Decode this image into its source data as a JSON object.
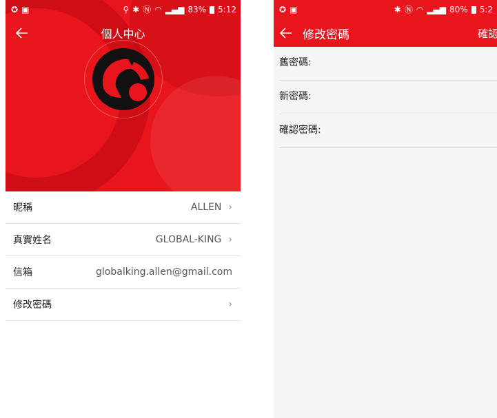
{
  "left": {
    "status": {
      "percent": "83%",
      "time": "5:12"
    },
    "title": "個人中心",
    "rows": [
      {
        "label": "昵稱",
        "value": "ALLEN",
        "chevron": true
      },
      {
        "label": "真實姓名",
        "value": "GLOBAL-KING",
        "chevron": true
      },
      {
        "label": "信箱",
        "value": "globalking.allen@gmail.com",
        "chevron": false
      },
      {
        "label": "修改密碼",
        "value": "",
        "chevron": true
      }
    ]
  },
  "right": {
    "status": {
      "percent": "80%",
      "time": "5:2"
    },
    "title": "修改密碼",
    "confirm": "確認",
    "fields": [
      {
        "label": "舊密碼:",
        "value": ""
      },
      {
        "label": "新密碼:",
        "value": ""
      },
      {
        "label": "確認密碼:",
        "value": ""
      }
    ]
  },
  "colors": {
    "accent": "#e8151c"
  },
  "icons": {
    "back": "arrow-left-icon",
    "chevron": "chevron-right-icon"
  }
}
